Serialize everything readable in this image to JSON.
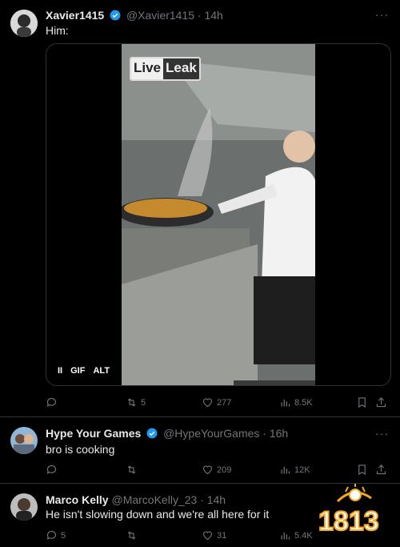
{
  "tweets": [
    {
      "name": "Xavier1415",
      "handle": "@Xavier1415",
      "time": "· 14h",
      "text": "Him:",
      "media": {
        "watermark_left": "Live",
        "watermark_right": "Leak",
        "pause": "II",
        "gif": "GIF",
        "alt": "ALT"
      },
      "stats": {
        "replies": "",
        "reposts": "5",
        "likes": "277",
        "views": "8.5K"
      }
    },
    {
      "name": "Hype Your Games",
      "handle": "@HypeYourGames",
      "time": "· 16h",
      "text": "bro is cooking",
      "stats": {
        "replies": "",
        "reposts": "",
        "likes": "209",
        "views": "12K"
      }
    },
    {
      "name": "Marco Kelly",
      "handle": "@MarcoKelly_23",
      "time": "· 14h",
      "text": "He isn't slowing down and we're all here for it",
      "stats": {
        "replies": "5",
        "reposts": "",
        "likes": "31",
        "views": "5.4K"
      }
    }
  ],
  "more_glyph": "···",
  "watermark": {
    "text": "1813"
  },
  "colors": {
    "verified": "#1d9bf0",
    "muted": "#71767b",
    "text": "#e7e9ea",
    "border": "#2f3336"
  }
}
